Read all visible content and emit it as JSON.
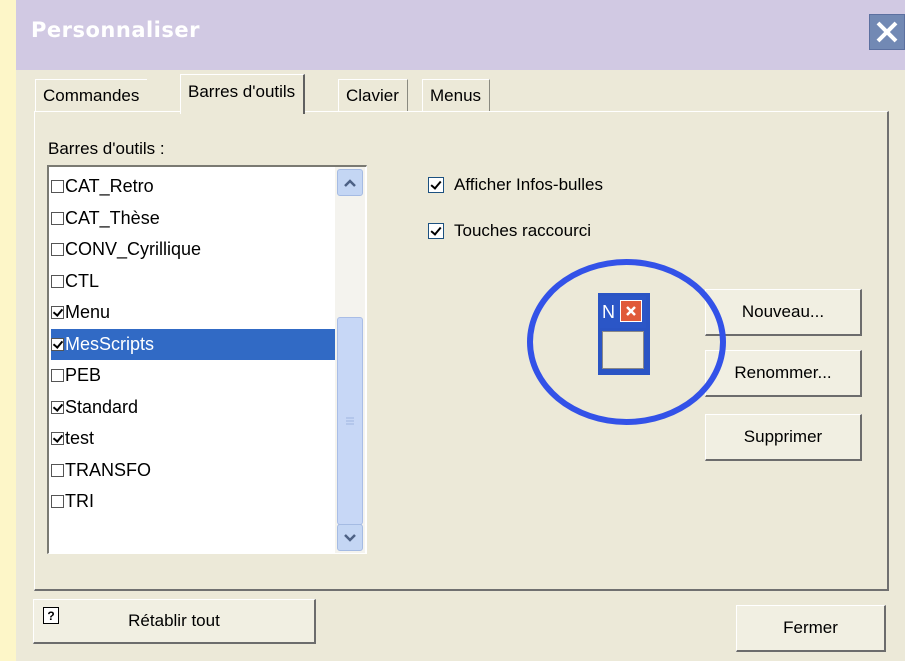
{
  "window": {
    "title": "Personnaliser"
  },
  "tabs": [
    {
      "label": "Commandes"
    },
    {
      "label": "Barres d'outils"
    },
    {
      "label": "Clavier"
    },
    {
      "label": "Menus"
    }
  ],
  "toolbars_list": {
    "label": "Barres d'outils :",
    "items": [
      {
        "label": "CAT_Retro",
        "checked": false
      },
      {
        "label": "CAT_Thèse",
        "checked": false
      },
      {
        "label": "CONV_Cyrillique",
        "checked": false
      },
      {
        "label": "CTL",
        "checked": false
      },
      {
        "label": "Menu",
        "checked": true
      },
      {
        "label": "MesScripts",
        "checked": true,
        "selected": true
      },
      {
        "label": "PEB",
        "checked": false
      },
      {
        "label": "Standard",
        "checked": true
      },
      {
        "label": "test",
        "checked": true
      },
      {
        "label": "TRANSFO",
        "checked": false
      },
      {
        "label": "TRI",
        "checked": false
      }
    ]
  },
  "options": {
    "tooltips": {
      "label": "Afficher Infos-bulles",
      "checked": true
    },
    "shortcuts": {
      "label": "Touches raccourci",
      "checked": true
    }
  },
  "preview": {
    "letter": "N"
  },
  "buttons": {
    "new": "Nouveau...",
    "rename": "Renommer...",
    "delete": "Supprimer",
    "reset_all": "Rétablir tout",
    "close": "Fermer"
  },
  "colors": {
    "highlight": "#316ac5",
    "annotation_circle": "#3352e8",
    "titlebar": "#d1c9e3",
    "close_button": "#7289b4"
  }
}
